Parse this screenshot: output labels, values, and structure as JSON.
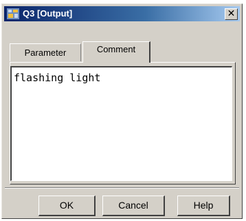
{
  "window": {
    "title": "Q3 [Output]",
    "app_icon": "program-block-icon",
    "close_glyph": "✕"
  },
  "tabs": [
    {
      "label": "Parameter",
      "selected": false
    },
    {
      "label": "Comment",
      "selected": true
    }
  ],
  "comment": {
    "value": "flashing light"
  },
  "buttons": {
    "ok": "OK",
    "cancel": "Cancel",
    "help": "Help"
  },
  "colors": {
    "face": "#d4d0c8",
    "title_start": "#0a246a",
    "title_end": "#a6caf0"
  }
}
